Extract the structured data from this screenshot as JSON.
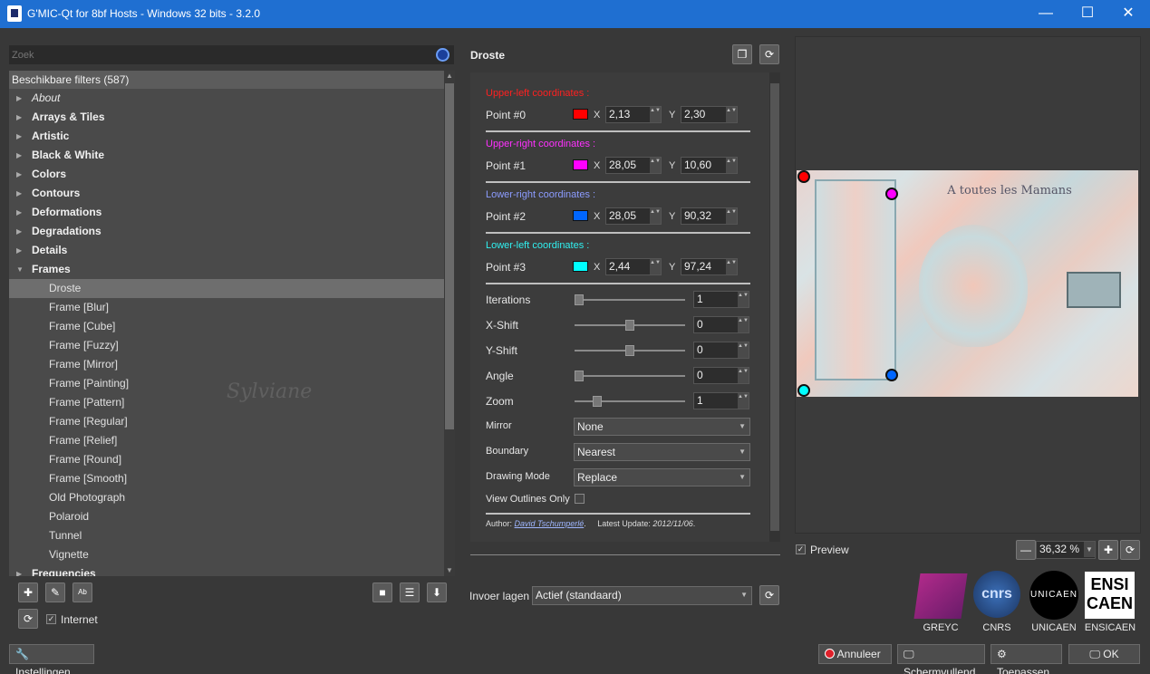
{
  "window": {
    "title": "G'MIC-Qt for 8bf Hosts - Windows 32 bits - 3.2.0",
    "minimize": "—",
    "maximize": "☐",
    "close": "✕"
  },
  "search": {
    "placeholder": "Zoek"
  },
  "tree": {
    "header": "Beschikbare filters (587)",
    "items": [
      {
        "label": "About",
        "kind": "about"
      },
      {
        "label": "Arrays & Tiles",
        "kind": "cat"
      },
      {
        "label": "Artistic",
        "kind": "cat"
      },
      {
        "label": "Black & White",
        "kind": "cat"
      },
      {
        "label": "Colors",
        "kind": "cat"
      },
      {
        "label": "Contours",
        "kind": "cat"
      },
      {
        "label": "Deformations",
        "kind": "cat"
      },
      {
        "label": "Degradations",
        "kind": "cat"
      },
      {
        "label": "Details",
        "kind": "cat"
      },
      {
        "label": "Frames",
        "kind": "cat-open"
      },
      {
        "label": "Droste",
        "kind": "child-sel"
      },
      {
        "label": "Frame [Blur]",
        "kind": "child"
      },
      {
        "label": "Frame [Cube]",
        "kind": "child"
      },
      {
        "label": "Frame [Fuzzy]",
        "kind": "child"
      },
      {
        "label": "Frame [Mirror]",
        "kind": "child"
      },
      {
        "label": "Frame [Painting]",
        "kind": "child"
      },
      {
        "label": "Frame [Pattern]",
        "kind": "child"
      },
      {
        "label": "Frame [Regular]",
        "kind": "child"
      },
      {
        "label": "Frame [Relief]",
        "kind": "child"
      },
      {
        "label": "Frame [Round]",
        "kind": "child"
      },
      {
        "label": "Frame [Smooth]",
        "kind": "child"
      },
      {
        "label": "Old Photograph",
        "kind": "child"
      },
      {
        "label": "Polaroid",
        "kind": "child"
      },
      {
        "label": "Tunnel",
        "kind": "child"
      },
      {
        "label": "Vignette",
        "kind": "child"
      },
      {
        "label": "Frequencies",
        "kind": "cat"
      }
    ]
  },
  "internet_label": "Internet",
  "settings_button": "Instellingen...",
  "filter": {
    "name": "Droste",
    "points": [
      {
        "caption": "Upper-left coordinates :",
        "caption_color": "#ff2020",
        "label": "Point #0",
        "color": "#ff0000",
        "x": "2,13",
        "y": "2,30"
      },
      {
        "caption": "Upper-right coordinates :",
        "caption_color": "#ff30ff",
        "label": "Point #1",
        "color": "#ff00ff",
        "x": "28,05",
        "y": "10,60"
      },
      {
        "caption": "Lower-right coordinates :",
        "caption_color": "#8c9cff",
        "label": "Point #2",
        "color": "#0066ff",
        "x": "28,05",
        "y": "90,32"
      },
      {
        "caption": "Lower-left coordinates :",
        "caption_color": "#30f0f0",
        "label": "Point #3",
        "color": "#00ffff",
        "x": "2,44",
        "y": "97,24"
      }
    ],
    "x_label": "X",
    "y_label": "Y",
    "sliders": [
      {
        "label": "Iterations",
        "value": "1",
        "level": 0.0
      },
      {
        "label": "X-Shift",
        "value": "0",
        "level": 0.5
      },
      {
        "label": "Y-Shift",
        "value": "0",
        "level": 0.5
      },
      {
        "label": "Angle",
        "value": "0",
        "level": 0.0
      },
      {
        "label": "Zoom",
        "value": "1",
        "level": 0.18
      }
    ],
    "combos": [
      {
        "label": "Mirror",
        "value": "None"
      },
      {
        "label": "Boundary",
        "value": "Nearest"
      },
      {
        "label": "Drawing Mode",
        "value": "Replace"
      }
    ],
    "view_outlines_label": "View Outlines Only",
    "author_prefix": "Author:",
    "author": "David Tschumperlé",
    "author_suffix": ".",
    "update_prefix": "Latest Update:",
    "update": "2012/11/06",
    "update_suffix": "."
  },
  "input_layers": {
    "label": "Invoer lagen",
    "value": "Actief (standaard)"
  },
  "preview": {
    "label": "Preview",
    "zoom": "36,32 %",
    "image_text": "A toutes les Mamans"
  },
  "logos": [
    "GREYC",
    "CNRS",
    "UNICAEN",
    "ENSICAEN"
  ],
  "logo_texts": {
    "cnrs": "cnrs",
    "unicaen": "UNICAEN",
    "ensicaen": "ENSI CAEN"
  },
  "watermark": "Sylviane",
  "buttons": {
    "cancel": "Annuleer",
    "fullscreen": "Schermvullend",
    "apply": "Toepassen",
    "ok": "OK"
  }
}
